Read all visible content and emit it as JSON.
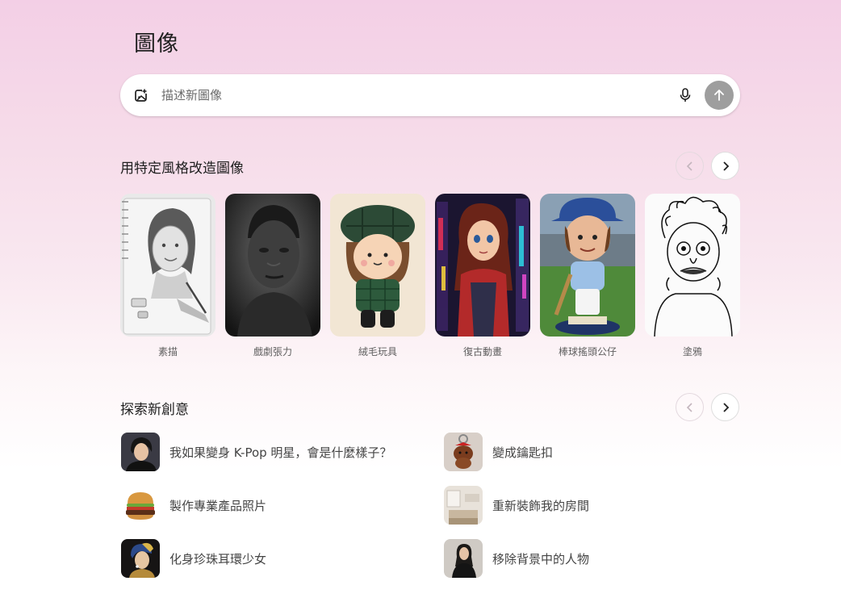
{
  "header": {
    "title": "圖像"
  },
  "prompt": {
    "placeholder": "描述新圖像"
  },
  "styles_section": {
    "title": "用特定風格改造圖像",
    "items": [
      {
        "label": "素描"
      },
      {
        "label": "戲劇張力"
      },
      {
        "label": "絨毛玩具"
      },
      {
        "label": "復古動畫"
      },
      {
        "label": "棒球搖頭公仔"
      },
      {
        "label": "塗鴉"
      }
    ]
  },
  "ideas_section": {
    "title": "探索新創意",
    "items": [
      {
        "label": "我如果變身 K-Pop 明星，會是什麼樣子？"
      },
      {
        "label": "變成鑰匙扣"
      },
      {
        "label": "製作專業產品照片"
      },
      {
        "label": "重新裝飾我的房間"
      },
      {
        "label": "化身珍珠耳環少女"
      },
      {
        "label": "移除背景中的人物"
      }
    ]
  },
  "icons": {
    "image_add": "image-plus-icon",
    "mic": "microphone-icon",
    "send": "arrow-up-icon",
    "prev": "chevron-left-icon",
    "next": "chevron-right-icon"
  },
  "colors": {
    "send_button": "#9e9e9e",
    "background_top": "#f3cfe6",
    "background_bottom": "#ffffff"
  }
}
